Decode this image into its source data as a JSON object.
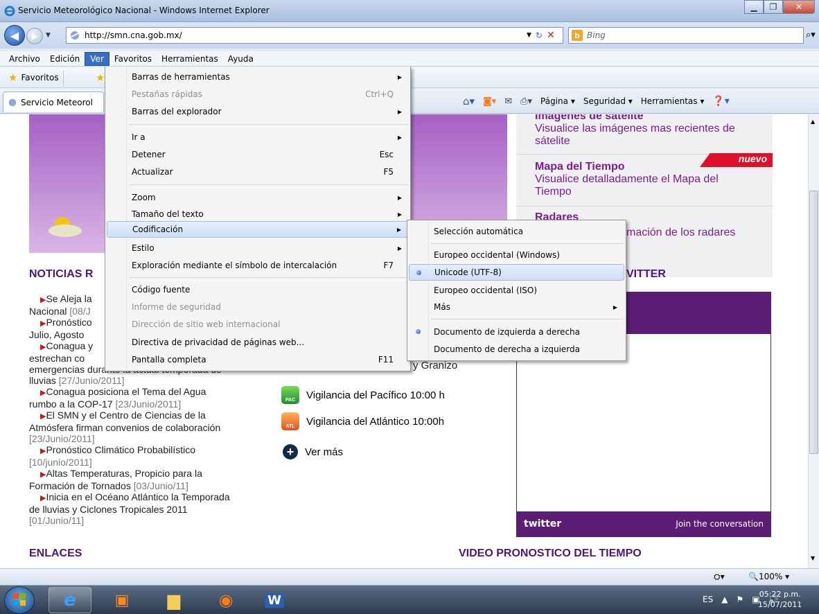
{
  "window": {
    "title": "Servicio Meteorológico Nacional - Windows Internet Explorer"
  },
  "address": {
    "url": "http://smn.cna.gob.mx/",
    "search_placeholder": "Bing"
  },
  "menubar": [
    "Archivo",
    "Edición",
    "Ver",
    "Favoritos",
    "Herramientas",
    "Ayuda"
  ],
  "favbar": {
    "favoritos": "Favoritos"
  },
  "tab": {
    "label": "Servicio Meteorol"
  },
  "cmdbar": {
    "pagina": "Página ▾",
    "seguridad": "Seguridad ▾",
    "herramientas": "Herramientas ▾"
  },
  "ver_menu": {
    "barras_herramientas": "Barras de herramientas",
    "pestanas_rapidas": "Pestañas rápidas",
    "pestanas_sc": "Ctrl+Q",
    "barras_explorador": "Barras del explorador",
    "ir_a": "Ir a",
    "detener": "Detener",
    "detener_sc": "Esc",
    "actualizar": "Actualizar",
    "actualizar_sc": "F5",
    "zoom": "Zoom",
    "tamano": "Tamaño del texto",
    "codificacion": "Codificación",
    "estilo": "Estilo",
    "exploracion": "Exploración mediante el símbolo de intercalación",
    "exploracion_sc": "F7",
    "codigo_fuente": "Código fuente",
    "informe": "Informe de seguridad",
    "direccion": "Dirección de sitio web internacional",
    "directiva": "Directiva de privacidad de páginas web...",
    "pantalla": "Pantalla completa",
    "pantalla_sc": "F11"
  },
  "sub_menu": {
    "auto": "Selección automática",
    "europeo_win": "Europeo occidental (Windows)",
    "unicode": "Unicode (UTF-8)",
    "europeo_iso": "Europeo occidental (ISO)",
    "mas": "Más",
    "izq_der": "Documento de izquierda a derecha",
    "der_izq": "Documento de derecha a izquierda"
  },
  "page": {
    "sat_title": "Imágenes de satélite",
    "sat_desc1": "Visualice las imágenes mas recientes de",
    "sat_desc2": "sátelite",
    "nuevo": "nuevo",
    "mapa_title": "Mapa del Tiempo",
    "mapa_desc1": "Visualice detalladamente el Mapa del",
    "mapa_desc2": "Tiempo",
    "radares_title": "Radares",
    "radares_desc": "mación de los radares",
    "noticias": "NOTICIAS R",
    "twitter_head": "VITTER",
    "twitter_logo": "twitter",
    "twitter_join": "Join the conversation",
    "granizo": "y Granizo",
    "vig_pac": "Vigilancia del Pacífico 10:00 h",
    "vig_atl": "Vigilancia del Atlántico 10:00h",
    "ver_mas": "Ver más",
    "pac": "PAC",
    "atl": "ATL",
    "enlaces": "ENLACES",
    "video": "VIDEO PRONOSTICO DEL TIEMPO",
    "news": [
      {
        "t": "Se Aleja la",
        "d": ""
      },
      {
        "t": "Nacional",
        "d": "[08/J"
      },
      {
        "t": "Pronóstico",
        "d": ""
      },
      {
        "t": "Julio, Agosto",
        "d": ""
      },
      {
        "t": "Conagua y",
        "d": ""
      },
      {
        "t": "estrechan co",
        "d": ""
      },
      {
        "t": "emergencias durante la actual temporada de",
        "d": ""
      },
      {
        "t": "lluvias",
        "d": "[27/Junio/2011]"
      },
      {
        "t": "Conagua posiciona el Tema del Agua",
        "d": ""
      },
      {
        "t": "rumbo a la COP-17",
        "d": "[23/Junio/2011]"
      },
      {
        "t": "El SMN y el Centro de Ciencias de la",
        "d": ""
      },
      {
        "t": "Atmósfera firman convenios de colaboración",
        "d": ""
      },
      {
        "t": "",
        "d": "[23/Junio/2011]"
      },
      {
        "t": "Pronóstico Climático Probabilístico",
        "d": ""
      },
      {
        "t": "",
        "d": "[10/junio/2011]"
      },
      {
        "t": "Altas Temperaturas, Propicio para la",
        "d": ""
      },
      {
        "t": "Formación de Tornados",
        "d": "[03/Junio/11]"
      },
      {
        "t": "Inicia en el Océano Atlántico la Temporada",
        "d": ""
      },
      {
        "t": "de lluvias y Ciclones Tropicales 2011",
        "d": ""
      },
      {
        "t": "",
        "d": "[01/Junio/11]"
      }
    ]
  },
  "status": {
    "zoom": "100%"
  },
  "tray": {
    "lang": "ES",
    "time": "05:22 p.m.",
    "date": "15/07/2011"
  }
}
